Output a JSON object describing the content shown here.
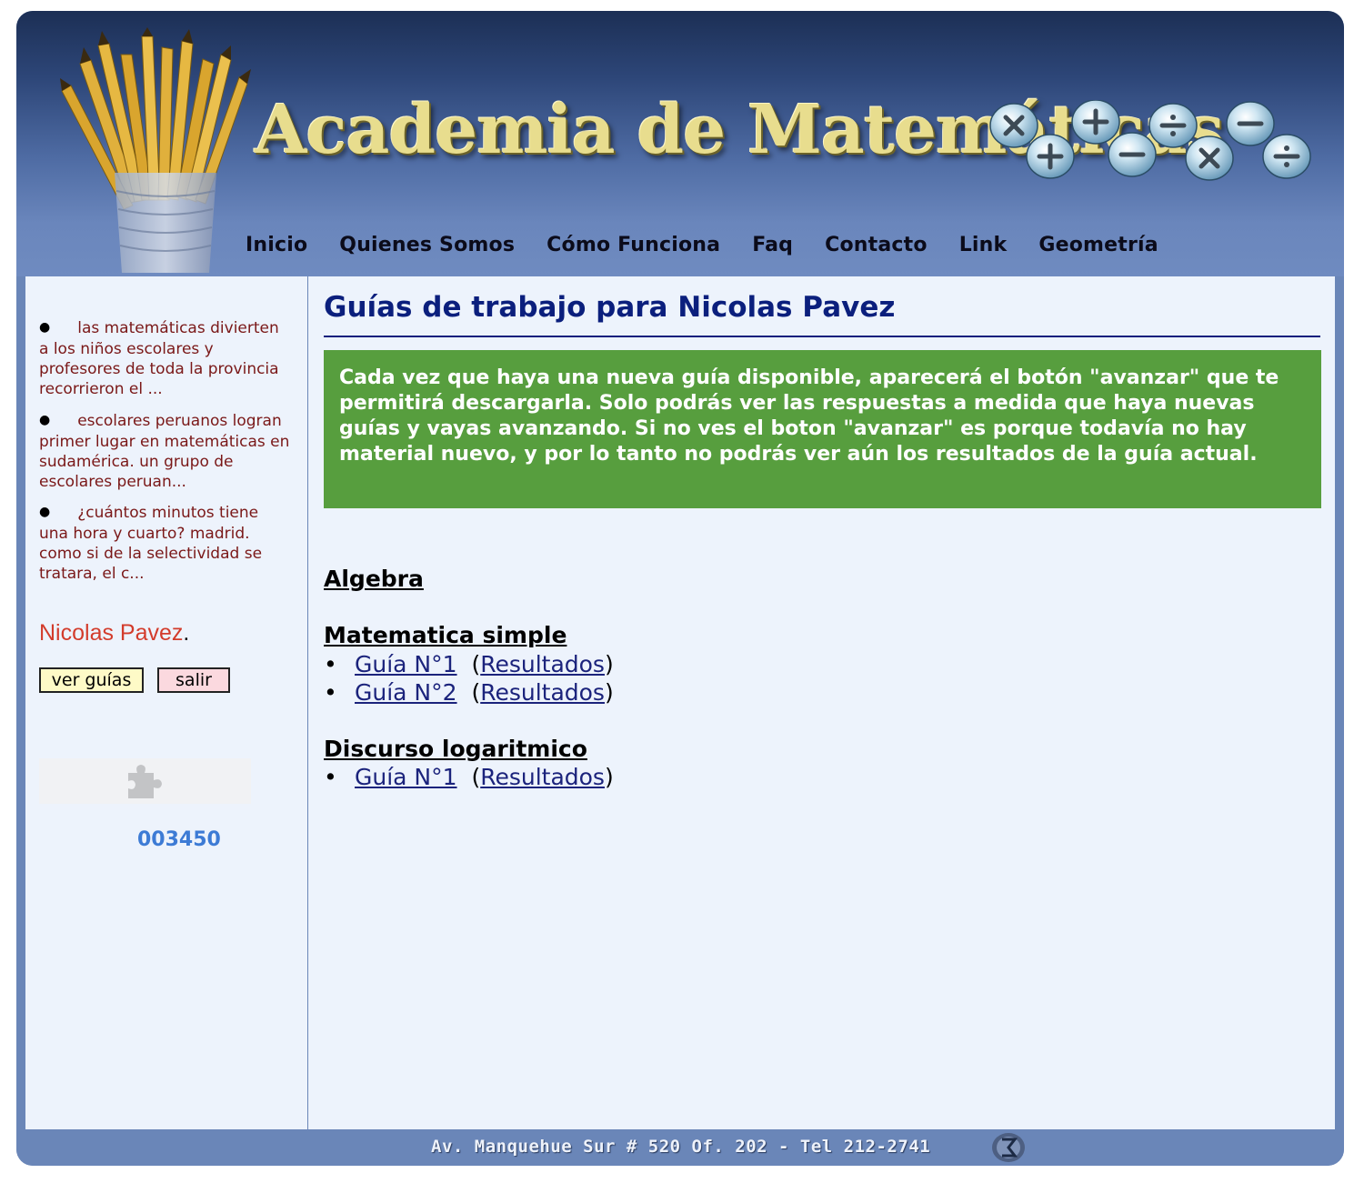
{
  "header": {
    "site_title": "Academia de Matemáticas",
    "nav": [
      "Inicio",
      "Quienes Somos",
      "Cómo Funciona",
      "Faq",
      "Contacto",
      "Link",
      "Geometría"
    ]
  },
  "sidebar": {
    "news": [
      {
        "lead": "las matemáticas divierten",
        "rest": "a los niños escolares y profesores de toda la provincia recorrieron el ..."
      },
      {
        "lead": "escolares peruanos logran",
        "rest": "primer lugar en matemáticas en sudamérica. un grupo de escolares peruan..."
      },
      {
        "lead": "¿cuántos minutos tiene",
        "rest": "una hora y cuarto? madrid. como si de la selectividad se tratara, el c..."
      }
    ],
    "user_name": "Nicolas Pavez",
    "user_suffix": ".",
    "buttons": {
      "ver_guias": "ver guías",
      "salir": "salir"
    },
    "counter": "003450"
  },
  "main": {
    "title": "Guías de trabajo para Nicolas Pavez",
    "notice": "Cada vez que haya una nueva guía disponible, aparecerá el botón \"avanzar\" que te permitirá descargarla. Solo podrás ver las respuestas a medida que haya nuevas guías y vayas avanzando. Si no ves el boton \"avanzar\" es porque todavía no hay material nuevo, y por lo tanto no podrás ver aún los resultados de la guía actual.",
    "sections": [
      {
        "name": "Algebra",
        "guides": []
      },
      {
        "name": "Matematica simple",
        "guides": [
          {
            "label": "Guía N°1",
            "results": "Resultados"
          },
          {
            "label": "Guía N°2",
            "results": "Resultados"
          }
        ]
      },
      {
        "name": "Discurso logaritmico",
        "guides": [
          {
            "label": "Guía N°1",
            "results": "Resultados"
          }
        ]
      }
    ]
  },
  "footer": {
    "address": "Av. Manquehue Sur # 520 Of. 202 - Tel 212-2741"
  },
  "colors": {
    "header_gradient_top": "#1c2f55",
    "frame": "#6a86b8",
    "content_bg": "#edf3fc",
    "title": "#0b1f7d",
    "notice_bg": "#579e3e",
    "news_text": "#7a1818",
    "user_name": "#d33c2c",
    "counter": "#3d7bd5",
    "link": "#1b237c"
  }
}
